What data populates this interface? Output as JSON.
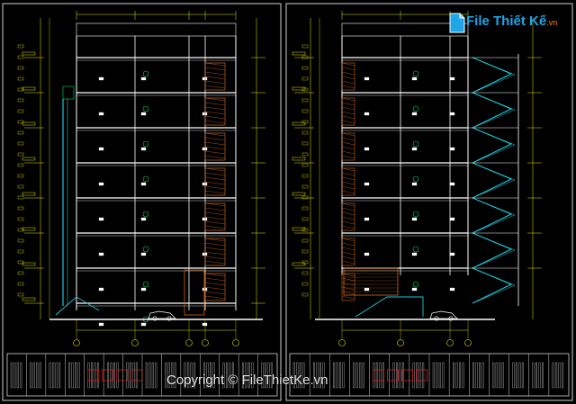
{
  "watermark": {
    "logo_text": "File Thiết Kế",
    "logo_site": ".vn",
    "copyright": "Copyright © FileThietKe.vn"
  },
  "drawing": {
    "left_elevation": {
      "floors": 8,
      "has_staircase": true,
      "has_car": true
    },
    "right_elevation": {
      "floors": 8,
      "has_external_stair": true,
      "has_car": true
    }
  },
  "colors": {
    "background": "#000000",
    "lines": "#ffffff",
    "dimensions": "#e8e800",
    "accent_green": "#00d060",
    "accent_cyan": "#1ec8d8",
    "hatch": "#c86420",
    "frame": "#d0d0d0"
  }
}
